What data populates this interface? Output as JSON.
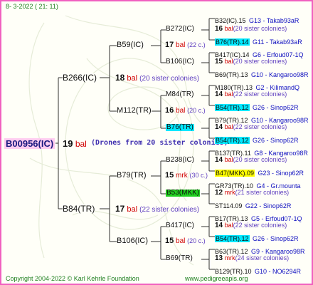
{
  "header": {
    "date": "8-  3-2022 ( 21: 11)"
  },
  "footer": {
    "copyright": "Copyright 2004-2022 © Karl Kehrle Foundation",
    "url": "www.pedigreeapis.org"
  },
  "colors": {
    "border": "#f060c0",
    "root_highlight": "#ffccf0",
    "cyan_highlight": "#00e8ff",
    "yellow_highlight": "#ffff00",
    "green_highlight": "#20d020",
    "bal": "#d00000",
    "mrk": "#d00000",
    "leaf_info": "#1010c0",
    "copyright": "#208020"
  },
  "root": {
    "id": "B00956(IC)",
    "num": "19",
    "unit": "bal",
    "note": "(Drones from 20 sister colonies)"
  },
  "gen2": [
    {
      "id": "B266(IC)",
      "num": "18",
      "unit": "bal",
      "note": "(20 sister colonies)"
    },
    {
      "id": "B84(TR)",
      "num": "17",
      "unit": "bal",
      "note": "(22 sister colonies)"
    }
  ],
  "gen3": [
    {
      "id": "B59(IC)",
      "num": "17",
      "unit": "bal",
      "note": "(22 c.)"
    },
    {
      "id": "M112(TR)",
      "num": "16",
      "unit": "bal",
      "note": "(20 c.)"
    },
    {
      "id": "B79(TR)",
      "num": "15",
      "unit": "mrk",
      "note": "(30 c.)"
    },
    {
      "id": "B106(IC)",
      "num": "15",
      "unit": "bal",
      "note": "(20 c.)"
    }
  ],
  "gen4": [
    {
      "id": "B272(IC)",
      "num": "16",
      "unit": "bal",
      "note": "(20 sister colonies)",
      "hl": ""
    },
    {
      "id": "B106(IC)",
      "num": "15",
      "unit": "bal",
      "note": "(20 sister colonies)",
      "hl": ""
    },
    {
      "id": "M84(TR)",
      "num": "14",
      "unit": "bal",
      "note": "(22 sister colonies)",
      "hl": ""
    },
    {
      "id": "B76(TR)",
      "num": "14",
      "unit": "bal",
      "note": "(22 sister colonies)",
      "hl": "cyan"
    },
    {
      "id": "B238(IC)",
      "num": "14",
      "unit": "bal",
      "note": "(20 sister colonies)",
      "hl": ""
    },
    {
      "id": "B53(MKK)",
      "num": "12",
      "unit": "mrk",
      "note": "(21 sister colonies)",
      "hl": "green"
    },
    {
      "id": "B417(IC)",
      "num": "14",
      "unit": "bal",
      "note": "(22 sister colonies)",
      "hl": ""
    },
    {
      "id": "B69(TR)",
      "num": "13",
      "unit": "mrk",
      "note": "(24 sister colonies)",
      "hl": ""
    }
  ],
  "gen5": [
    {
      "id": "B32(IC).15",
      "info": "G13 - Takab93aR",
      "hl": ""
    },
    {
      "id": "B76(TR).14",
      "info": "G11 - Takab93aR",
      "hl": "cyan"
    },
    {
      "id": "B417(IC).14",
      "info": "G6 - Erfoud07-1Q",
      "hl": ""
    },
    {
      "id": "B69(TR).13",
      "info": "G10 - Kangaroo98R",
      "hl": ""
    },
    {
      "id": "M180(TR).13",
      "info": "G2 - KilimandQ",
      "hl": ""
    },
    {
      "id": "B54(TR).12",
      "info": "G26 - Sinop62R",
      "hl": "cyan"
    },
    {
      "id": "B79(TR).12",
      "info": "G10 - Kangaroo98R",
      "hl": ""
    },
    {
      "id": "B54(TR).12",
      "info": "G26 - Sinop62R",
      "hl": "cyan"
    },
    {
      "id": "B137(TR).11",
      "info": "G8 - Kangaroo98R",
      "hl": ""
    },
    {
      "id": "B47(MKK).09",
      "info": "G23 - Sinop62R",
      "hl": "yellow"
    },
    {
      "id": "GR73(TR).10",
      "info": "G4 - Gr.mounta",
      "hl": ""
    },
    {
      "id": "ST114.09",
      "info": "G22 - Sinop62R",
      "hl": ""
    },
    {
      "id": "B17(TR).13",
      "info": "G5 - Erfoud07-1Q",
      "hl": ""
    },
    {
      "id": "B54(TR).12",
      "info": "G26 - Sinop62R",
      "hl": "cyan"
    },
    {
      "id": "B63(TR).12",
      "info": "G9 - Kangaroo98R",
      "hl": ""
    },
    {
      "id": "B129(TR).10",
      "info": "G10 - NO6294R",
      "hl": ""
    }
  ]
}
